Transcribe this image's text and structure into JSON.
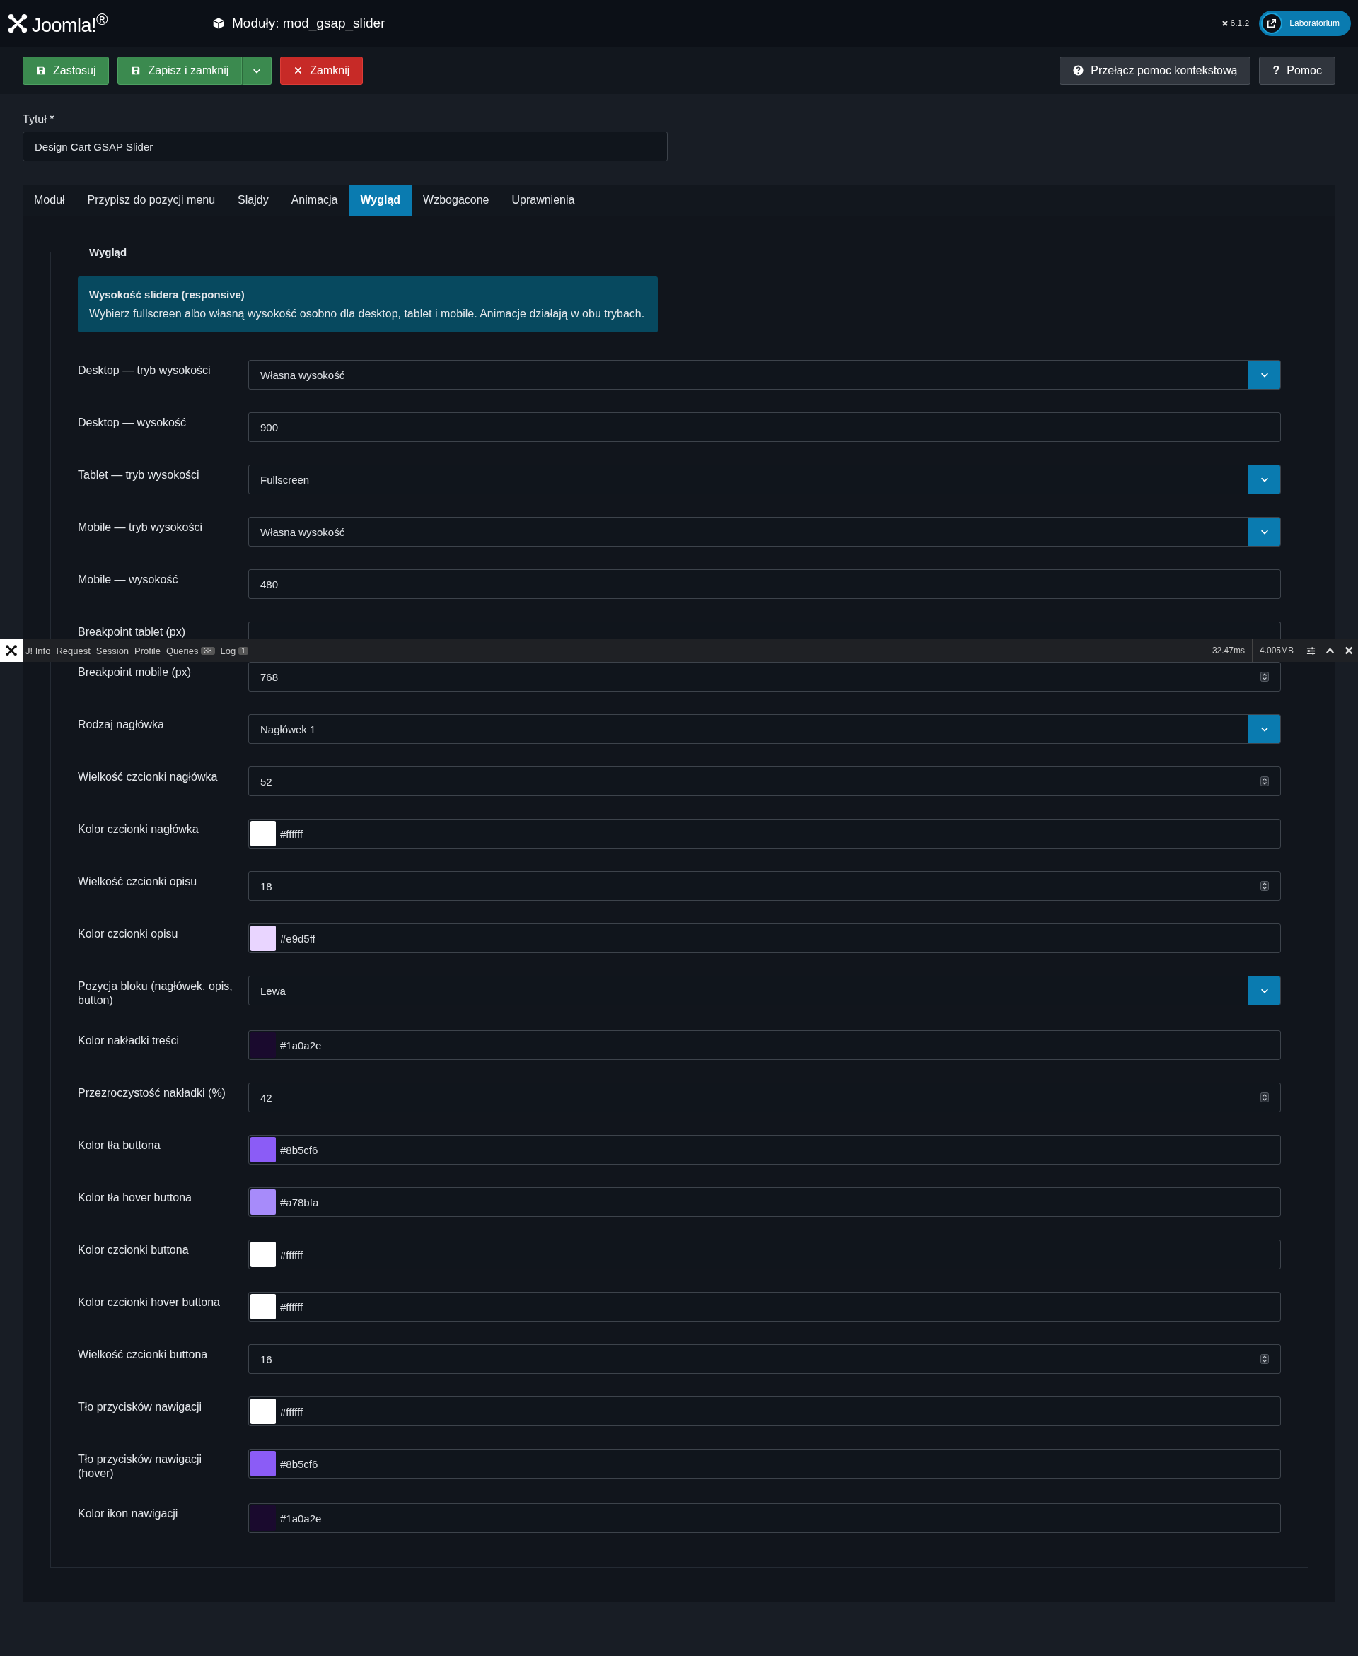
{
  "header": {
    "brand": "Joomla!$^{®}$",
    "title": "Moduły: mod_gsap_slider",
    "version": "6.1.2",
    "site_button": "Laboratorium"
  },
  "toolbar": {
    "left": [
      {
        "label": "Zastosuj",
        "kind": "save"
      },
      {
        "label": "Zapisz i zamknij",
        "kind": "split"
      },
      {
        "label": "Zamknij",
        "kind": "close"
      }
    ],
    "right": [
      {
        "label": "Przełącz pomoc kontekstową",
        "kind": "toggle"
      },
      {
        "label": "Pomoc",
        "kind": "help",
        "icon": "?"
      }
    ]
  },
  "title_field": {
    "label": "Tytuł *",
    "value": "Design Cart GSAP Slider"
  },
  "tabs": [
    {
      "label": "Moduł",
      "selected": false
    },
    {
      "label": "Przypisz do pozycji menu",
      "selected": false
    },
    {
      "label": "Slajdy",
      "selected": false
    },
    {
      "label": "Animacja",
      "selected": false
    },
    {
      "label": "Wygląd",
      "selected": true
    },
    {
      "label": "Wzbogacone",
      "selected": false
    },
    {
      "label": "Uprawnienia",
      "selected": false
    }
  ],
  "fieldset": {
    "legend": "Wygląd",
    "info": {
      "title": "Wysokość slidera (responsive)",
      "text": "Wybierz fullscreen albo własną wysokość osobno dla desktop, tablet i mobile. Animacje działają w obu trybach."
    },
    "fields": [
      {
        "label": "Desktop — tryb wysokości",
        "kind": "select",
        "value": "Własna wysokość"
      },
      {
        "label": "Desktop — wysokość",
        "kind": "text",
        "value": "900"
      },
      {
        "label": "Tablet — tryb wysokości",
        "kind": "select",
        "value": "Fullscreen"
      },
      {
        "label": "Mobile — tryb wysokości",
        "kind": "select",
        "value": "Własna wysokość"
      },
      {
        "label": "Mobile — wysokość",
        "kind": "text",
        "value": "480"
      },
      {
        "label": "Breakpoint tablet (px)",
        "kind": "number"
      },
      {
        "label": "Breakpoint mobile (px)",
        "kind": "number",
        "value": "768"
      },
      {
        "label": "Rodzaj nagłówka",
        "kind": "select",
        "value": "Nagłówek 1"
      },
      {
        "label": "Wielkość czcionki nagłówka",
        "kind": "number",
        "value": "52"
      },
      {
        "label": "Kolor czcionki nagłówka",
        "kind": "color",
        "value": "#ffffff",
        "color": "#ffffff"
      },
      {
        "label": "Wielkość czcionki opisu",
        "kind": "number",
        "value": "18"
      },
      {
        "label": "Kolor czcionki opisu",
        "kind": "color",
        "value": "#e9d5ff",
        "color": "#e9d5ff"
      },
      {
        "label": "Pozycja bloku (nagłówek, opis, button)",
        "kind": "select",
        "value": "Lewa"
      },
      {
        "label": "Kolor nakładki treści",
        "kind": "color",
        "value": "#1a0a2e",
        "color": "#1a0a2e"
      },
      {
        "label": "Przezroczystość nakładki (%)",
        "kind": "number",
        "value": "42"
      },
      {
        "label": "Kolor tła buttona",
        "kind": "color",
        "value": "#8b5cf6",
        "color": "#8b5cf6"
      },
      {
        "label": "Kolor tła hover buttona",
        "kind": "color",
        "value": "#a78bfa",
        "color": "#a78bfa"
      },
      {
        "label": "Kolor czcionki buttona",
        "kind": "color",
        "value": "#ffffff",
        "color": "#ffffff"
      },
      {
        "label": "Kolor czcionki hover buttona",
        "kind": "color",
        "value": "#ffffff",
        "color": "#ffffff"
      },
      {
        "label": "Wielkość czcionki buttona",
        "kind": "number",
        "value": "16"
      },
      {
        "label": "Tło przycisków nawigacji",
        "kind": "color",
        "value": "#ffffff",
        "color": "#ffffff"
      },
      {
        "label": "Tło przycisków nawigacji (hover)",
        "kind": "color",
        "value": "#8b5cf6",
        "color": "#8b5cf6"
      },
      {
        "label": "Kolor ikon nawigacji",
        "kind": "color",
        "value": "#1a0a2e",
        "color": "#1a0a2e"
      }
    ]
  },
  "debug_bar": {
    "items": [
      {
        "label": "J! Info"
      },
      {
        "label": "Request"
      },
      {
        "label": "Session"
      },
      {
        "label": "Profile"
      },
      {
        "label": "Queries",
        "badge": "38"
      },
      {
        "label": "Log",
        "badge": "1"
      }
    ],
    "time": "32.47ms",
    "memory": "4.005MB"
  }
}
